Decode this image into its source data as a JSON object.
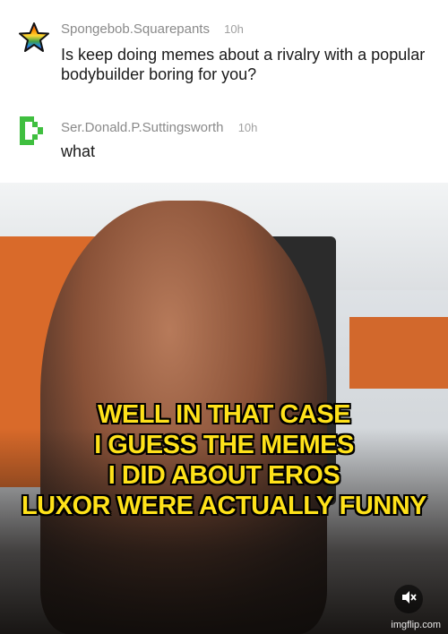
{
  "comments": [
    {
      "username": "Spongebob.Squarepants",
      "time": "10h",
      "text": "Is keep doing memes about a rivalry with a popular bodybuilder boring for you?",
      "avatar_icon": "rainbow-star-icon"
    },
    {
      "username": "Ser.Donald.P.Suttingsworth",
      "time": "10h",
      "text": "what",
      "avatar_icon": "green-pixel-d-icon"
    }
  ],
  "meme": {
    "caption_lines": [
      "WELL IN THAT CASE",
      "I GUESS THE MEMES",
      "I DID ABOUT EROS",
      "LUXOR WERE ACTUALLY FUNNY"
    ],
    "mute_icon": "muted-speaker-icon",
    "watermark": "imgflip.com"
  },
  "colors": {
    "caption": "#ffe21a",
    "username": "#8a8a8a",
    "text": "#1a1a1a",
    "avatar_green": "#3fbf3f"
  }
}
